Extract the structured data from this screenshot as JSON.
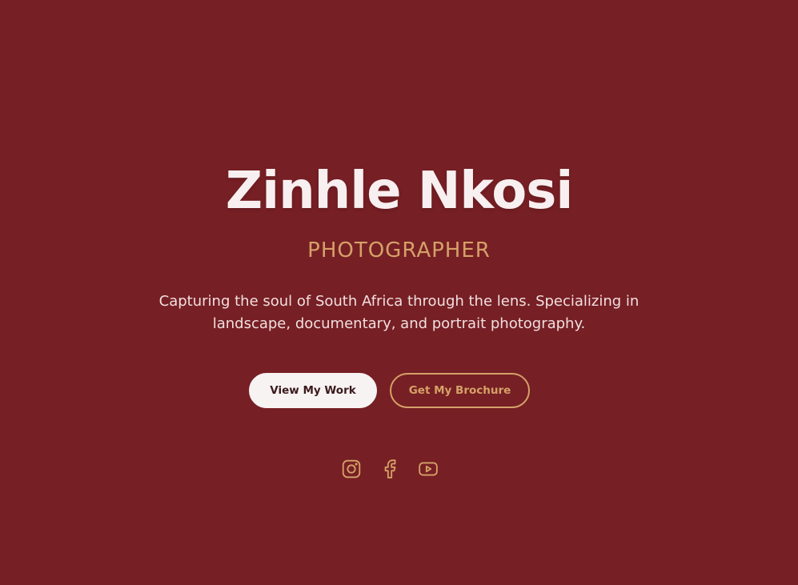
{
  "hero": {
    "name": "Zinhle Nkosi",
    "role": "PHOTOGRAPHER",
    "tagline": "Capturing the soul of South Africa through the lens. Specializing in landscape, documentary, and portrait photography."
  },
  "buttons": {
    "primary_label": "View My Work",
    "secondary_label": "Get My Brochure"
  },
  "social": {
    "icons": [
      "instagram-icon",
      "facebook-icon",
      "youtube-icon"
    ]
  },
  "colors": {
    "background": "#761f24",
    "accent": "#d5a168",
    "heading": "#f8eff0",
    "button_light": "#f8f3f3"
  }
}
